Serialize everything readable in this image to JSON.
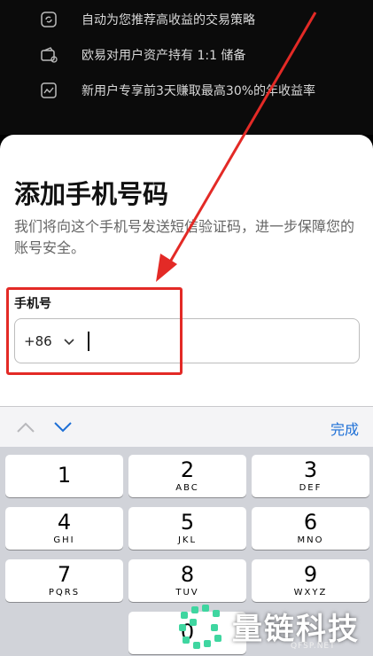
{
  "features": [
    {
      "icon": "refresh-strategy-icon",
      "text": "自动为您推荐高收益的交易策略"
    },
    {
      "icon": "wallet-reserve-icon",
      "text": "欧易对用户资产持有 1:1 储备"
    },
    {
      "icon": "chart-growth-icon",
      "text": "新用户专享前3天赚取最高30%的年收益率"
    }
  ],
  "sheet": {
    "title": "添加手机号码",
    "description": "我们将向这个手机号发送短信验证码，进一步保障您的账号安全。",
    "phone_label": "手机号",
    "country_code": "+86"
  },
  "keyboard": {
    "done_label": "完成",
    "keys": [
      {
        "digit": "1",
        "letters": ""
      },
      {
        "digit": "2",
        "letters": "ABC"
      },
      {
        "digit": "3",
        "letters": "DEF"
      },
      {
        "digit": "4",
        "letters": "GHI"
      },
      {
        "digit": "5",
        "letters": "JKL"
      },
      {
        "digit": "6",
        "letters": "MNO"
      },
      {
        "digit": "7",
        "letters": "PQRS"
      },
      {
        "digit": "8",
        "letters": "TUV"
      },
      {
        "digit": "9",
        "letters": "WXYZ"
      },
      {
        "digit": "0",
        "letters": ""
      }
    ]
  },
  "watermark": {
    "text": "量链科技",
    "sub": "QFSP.NET"
  },
  "colors": {
    "annotation": "#e32a26",
    "accent": "#1d6fd6"
  }
}
